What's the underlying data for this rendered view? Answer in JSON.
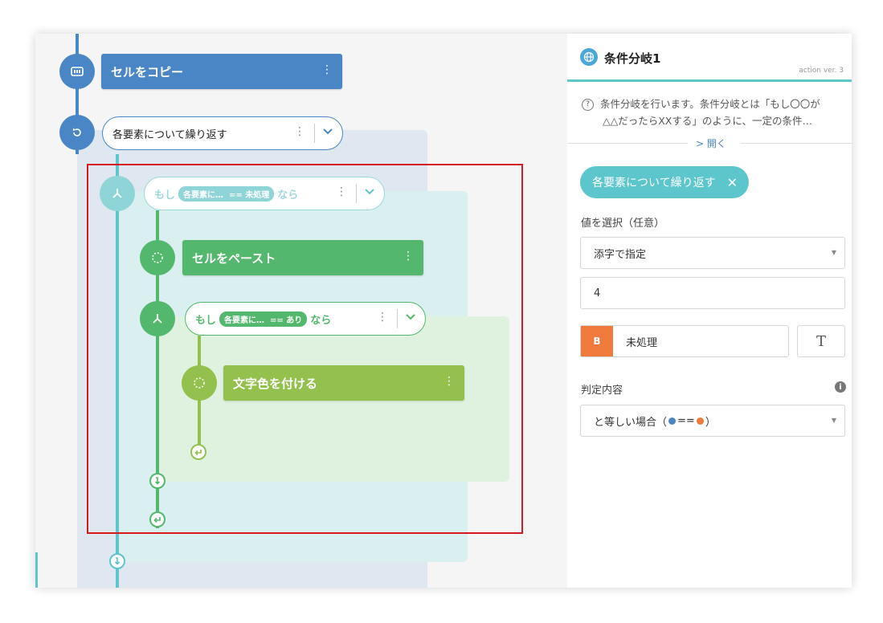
{
  "flow": {
    "copy_card": "セルをコピー",
    "loop_label": "各要素について繰り返す",
    "if1": {
      "prefix": "もし",
      "var": "各要素に…",
      "cond": "== 未処理",
      "suffix": "なら"
    },
    "paste_card": "セルをペースト",
    "if2": {
      "prefix": "もし",
      "var": "各要素に…",
      "cond": "== あり",
      "suffix": "なら"
    },
    "color_card": "文字色を付ける",
    "more_icon": "⋮",
    "chevron_icon": "⌄"
  },
  "panel": {
    "title": "条件分岐1",
    "version": "action ver. 3",
    "description_line1": "条件分岐を行います。条件分岐とは「もし〇〇が",
    "description_line2": "△△だったらXXする」のように、一定の条件…",
    "open_link": "> 開く",
    "chip_label": "各要素について繰り返す",
    "chip_close": "✕",
    "value_label": "値を選択（任意）",
    "index_select": "添字で指定",
    "index_value": "4",
    "b_badge": "B",
    "b_value": "未処理",
    "t_button": "T",
    "judge_label": "判定内容",
    "judge_prefix": "と等しい場合（",
    "judge_eq": "==",
    "judge_suffix": "）"
  },
  "colors": {
    "blue": "#4a86c5",
    "teal": "#5cc6cc",
    "green": "#53b86d",
    "lime": "#94c04d",
    "orange": "#f07a3c",
    "highlight": "#d6191f"
  }
}
